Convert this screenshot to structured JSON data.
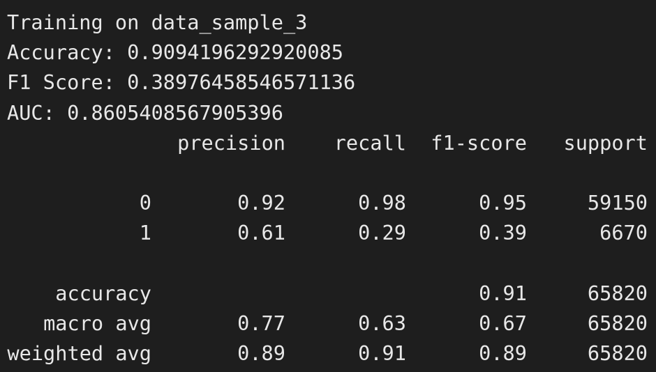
{
  "output": {
    "training_line": "Training on data_sample_3",
    "accuracy_line": "Accuracy: 0.9094196292920085",
    "f1_line": "F1 Score: 0.38976458546571136",
    "auc_line": "AUC: 0.8605408567905396"
  },
  "report": {
    "headers": [
      "precision",
      "recall",
      "f1-score",
      "support"
    ],
    "rows": [
      {
        "label": "0",
        "precision": "0.92",
        "recall": "0.98",
        "f1": "0.95",
        "support": "59150"
      },
      {
        "label": "1",
        "precision": "0.61",
        "recall": "0.29",
        "f1": "0.39",
        "support": "6670"
      }
    ],
    "summary": [
      {
        "label": "accuracy",
        "precision": "",
        "recall": "",
        "f1": "0.91",
        "support": "65820"
      },
      {
        "label": "macro avg",
        "precision": "0.77",
        "recall": "0.63",
        "f1": "0.67",
        "support": "65820"
      },
      {
        "label": "weighted avg",
        "precision": "0.89",
        "recall": "0.91",
        "f1": "0.89",
        "support": "65820"
      }
    ]
  }
}
